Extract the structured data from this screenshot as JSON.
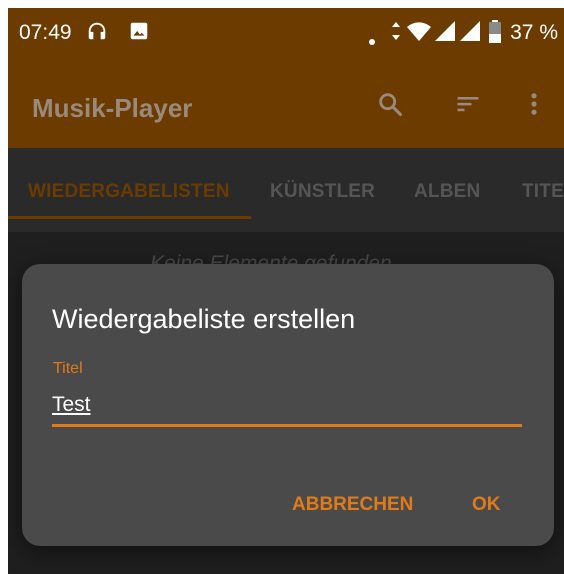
{
  "status_bar": {
    "time": "07:49",
    "battery": "37 %"
  },
  "app_bar": {
    "title": "Musik-Player",
    "actions": [
      "search-icon",
      "sort-icon",
      "more-vert-icon"
    ]
  },
  "tabs": [
    {
      "label": "WIEDERGABELISTEN",
      "active": true
    },
    {
      "label": "KÜNSTLER",
      "active": false
    },
    {
      "label": "ALBEN",
      "active": false
    },
    {
      "label": "TITEL",
      "active": false
    }
  ],
  "empty_state": "Keine Elemente gefunden",
  "dialog": {
    "title": "Wiedergabeliste erstellen",
    "field_label": "Titel",
    "field_value": "Test",
    "cancel_label": "ABBRECHEN",
    "ok_label": "OK"
  },
  "colors": {
    "app_bar": "#6b3b00",
    "accent": "#e07b1a",
    "background": "#1f1f1f",
    "dialog": "#4a4a4a"
  }
}
